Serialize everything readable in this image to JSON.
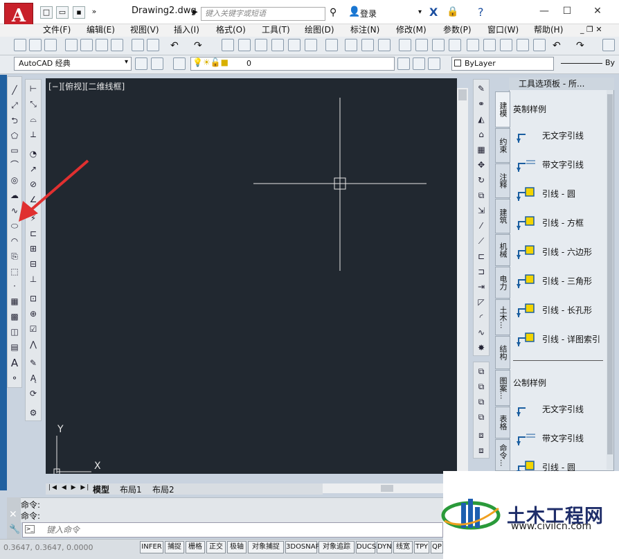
{
  "app": {
    "doc_title": "Drawing2.dwg",
    "search_placeholder": "键入关键字或短语",
    "login": "登录"
  },
  "menu": [
    "文件(F)",
    "编辑(E)",
    "视图(V)",
    "插入(I)",
    "格式(O)",
    "工具(T)",
    "绘图(D)",
    "标注(N)",
    "修改(M)",
    "参数(P)",
    "窗口(W)",
    "帮助(H)"
  ],
  "toolbar": {
    "workspace": "AutoCAD 经典",
    "layer": "0",
    "color": "ByLayer",
    "lineweight_label": "By"
  },
  "viewport": {
    "label": "[−][俯视][二维线框]",
    "ucs_x": "X",
    "ucs_y": "Y"
  },
  "layout_tabs": [
    "模型",
    "布局1",
    "布局2"
  ],
  "palette": {
    "title": "工具选项板 - 所...",
    "side_tabs": [
      "建模",
      "约束",
      "注释",
      "建筑",
      "机械",
      "电力",
      "土木...",
      "结构",
      "图案...",
      "表格",
      "命令..."
    ],
    "group1": "英制样例",
    "group1_items": [
      "无文字引线",
      "带文字引线",
      "引线 - 圆",
      "引线 - 方框",
      "引线 - 六边形",
      "引线 - 三角形",
      "引线 - 长孔形",
      "引线 - 详图索引"
    ],
    "group2": "公制样例",
    "group2_items": [
      "无文字引线",
      "带文字引线",
      "引线 - 圆"
    ]
  },
  "command": {
    "line1": "命令:",
    "line2": "命令:",
    "input_placeholder": "键入命令",
    "coords": "0.3647, 0.3647, 0.0000"
  },
  "status_buttons": [
    "INFER",
    "捕捉",
    "栅格",
    "正交",
    "极轴",
    "对象捕捉",
    "3DOSNAP",
    "对象追踪",
    "DUCS",
    "DYN",
    "线宽",
    "TPY",
    "QP"
  ],
  "watermark": {
    "brand": "土木工程网",
    "url": "www.civilcn.com"
  },
  "colors": {
    "canvas": "#212830",
    "annotation_arrow": "#e03030",
    "logo": "#c8202a"
  }
}
